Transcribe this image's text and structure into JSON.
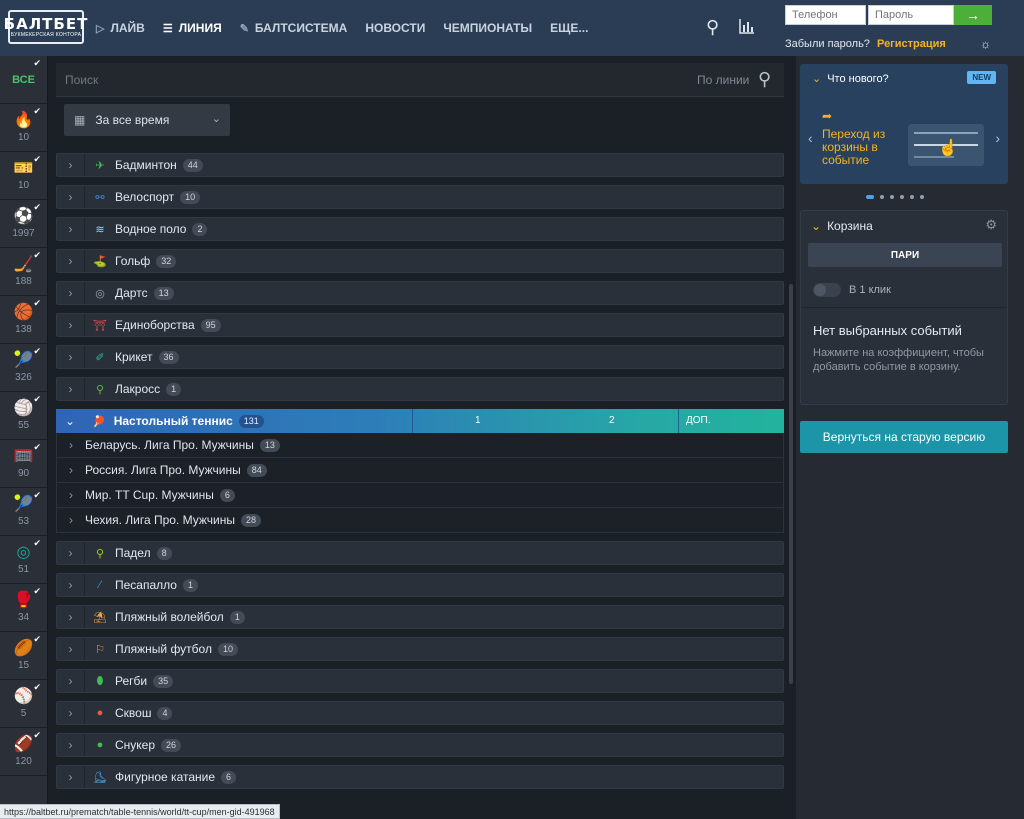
{
  "header": {
    "logo_main": "БАЛТБЕТ",
    "logo_sub": "БУКМЕКЕРСКАЯ КОНТОРА",
    "nav": [
      {
        "icon": "▷",
        "label": "ЛАЙВ"
      },
      {
        "icon": "☰",
        "label": "ЛИНИЯ"
      },
      {
        "icon": "✎",
        "label": "БАЛТСИСТЕМА"
      },
      {
        "icon": "",
        "label": "НОВОСТИ"
      },
      {
        "icon": "",
        "label": "ЧЕМПИОНАТЫ"
      },
      {
        "icon": "",
        "label": "ЕЩЕ..."
      }
    ],
    "phone_placeholder": "Телефон",
    "password_placeholder": "Пароль",
    "login_arrow": "→",
    "forgot": "Забыли пароль?",
    "register": "Регистрация",
    "search_icon": "⚲",
    "stats_icon": "📊",
    "theme_icon": "☼"
  },
  "leftbar": {
    "all_label": "ВСЕ",
    "sports": [
      {
        "icon": "🔥",
        "count": "10",
        "color": "#e8523b"
      },
      {
        "icon": "🎫",
        "count": "10",
        "color": "#f08a3a"
      },
      {
        "icon": "⚽",
        "count": "1997",
        "color": "#2ea34a"
      },
      {
        "icon": "🏒",
        "count": "188",
        "color": "#7ab6e0"
      },
      {
        "icon": "🏀",
        "count": "138",
        "color": "#e88035"
      },
      {
        "icon": "🎾",
        "count": "326",
        "color": "#f59d1c"
      },
      {
        "icon": "🏐",
        "count": "55",
        "color": "#e24f3a"
      },
      {
        "icon": "🥅",
        "count": "90",
        "color": "#e24f3a"
      },
      {
        "icon": "🎾",
        "count": "53",
        "color": "#4cb54e"
      },
      {
        "icon": "◎",
        "count": "51",
        "color": "#22a7a0"
      },
      {
        "icon": "🥊",
        "count": "34",
        "color": "#e0383a"
      },
      {
        "icon": "🏉",
        "count": "15",
        "color": "#f2c21b"
      },
      {
        "icon": "⚾",
        "count": "5",
        "color": "#d24242"
      },
      {
        "icon": "🏈",
        "count": "120",
        "color": "#4aa84a"
      }
    ]
  },
  "main": {
    "search_placeholder": "Поиск",
    "search_scope": "По линии",
    "search_icon": "⚲",
    "period": "За все время",
    "sports": [
      {
        "name": "Бадминтон",
        "count": "44",
        "icon": "✈",
        "color": "#3fbd55"
      },
      {
        "name": "Велоспорт",
        "count": "10",
        "icon": "⚯",
        "color": "#3c8fe0"
      },
      {
        "name": "Водное поло",
        "count": "2",
        "icon": "≋",
        "color": "#9cd1f2"
      },
      {
        "name": "Гольф",
        "count": "32",
        "icon": "⛳",
        "color": "#3fbd8c"
      },
      {
        "name": "Дартс",
        "count": "13",
        "icon": "◎",
        "color": "#9aa3ad"
      },
      {
        "name": "Единоборства",
        "count": "95",
        "icon": "⛩",
        "color": "#e24c4c"
      },
      {
        "name": "Крикет",
        "count": "36",
        "icon": "✐",
        "color": "#2fb7a0"
      },
      {
        "name": "Лакросс",
        "count": "1",
        "icon": "⚲",
        "color": "#5db84a"
      }
    ],
    "expanded": {
      "name": "Настольный теннис",
      "count": "131",
      "icon": "🏓",
      "col1": "1",
      "col2": "2",
      "col3": "ДОП.",
      "leagues": [
        {
          "name": "Беларусь. Лига Про. Мужчины",
          "count": "13"
        },
        {
          "name": "Россия. Лига Про. Мужчины",
          "count": "84"
        },
        {
          "name": "Мир. TT Cup. Мужчины",
          "count": "6"
        },
        {
          "name": "Чехия. Лига Про. Мужчины",
          "count": "28"
        }
      ]
    },
    "sports_after": [
      {
        "name": "Падел",
        "count": "8",
        "icon": "⚲",
        "color": "#9ad02a"
      },
      {
        "name": "Песапалло",
        "count": "1",
        "icon": "⁄",
        "color": "#3c8fe0"
      },
      {
        "name": "Пляжный волейбол",
        "count": "1",
        "icon": "⛱",
        "color": "#e8a64a"
      },
      {
        "name": "Пляжный футбол",
        "count": "10",
        "icon": "⚐",
        "color": "#e8a64a"
      },
      {
        "name": "Регби",
        "count": "35",
        "icon": "⬮",
        "color": "#3fbd55"
      },
      {
        "name": "Сквош",
        "count": "4",
        "icon": "●",
        "color": "#e85b4a"
      },
      {
        "name": "Снукер",
        "count": "26",
        "icon": "●",
        "color": "#3fbd55"
      },
      {
        "name": "Фигурное катание",
        "count": "6",
        "icon": "⛸",
        "color": "#4aa7e8"
      }
    ]
  },
  "right": {
    "whatsnew_title": "Что нового?",
    "new_badge": "NEW",
    "whatsnew_text": "Переход из корзины в событие",
    "basket_title": "Корзина",
    "pari": "ПАРИ",
    "oneclick": "В 1 клик",
    "empty_title": "Нет выбранных событий",
    "empty_desc": "Нажмите на коэффициент, чтобы добавить событие в корзину.",
    "old_version": "Вернуться на старую версию"
  },
  "status_url": "https://baltbet.ru/prematch/table-tennis/world/tt-cup/men-gid-491968"
}
